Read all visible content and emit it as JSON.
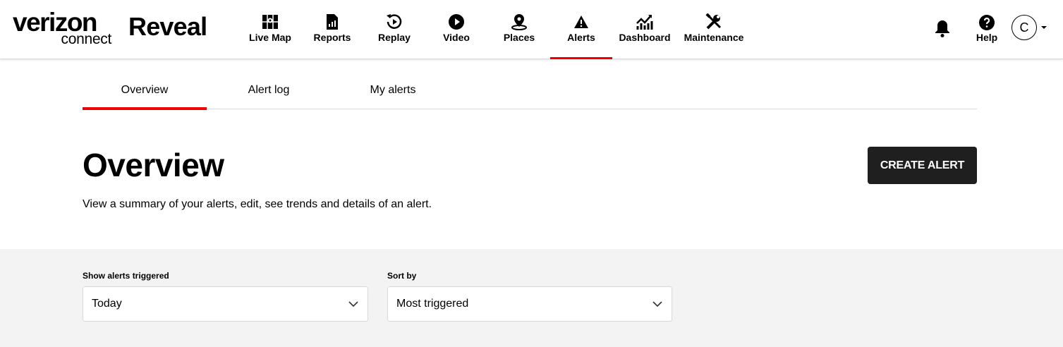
{
  "brand": {
    "company": "verizon",
    "suffix": "connect",
    "product": "Reveal"
  },
  "nav": {
    "items": [
      {
        "label": "Live Map",
        "icon": "map-icon"
      },
      {
        "label": "Reports",
        "icon": "report-icon"
      },
      {
        "label": "Replay",
        "icon": "replay-icon"
      },
      {
        "label": "Video",
        "icon": "play-icon"
      },
      {
        "label": "Places",
        "icon": "place-pin-icon"
      },
      {
        "label": "Alerts",
        "icon": "warning-icon",
        "active": true
      },
      {
        "label": "Dashboard",
        "icon": "chart-icon"
      },
      {
        "label": "Maintenance",
        "icon": "tools-icon"
      }
    ],
    "help_label": "Help",
    "user_initial": "C"
  },
  "tabs": [
    {
      "label": "Overview",
      "active": true
    },
    {
      "label": "Alert log"
    },
    {
      "label": "My alerts"
    }
  ],
  "page": {
    "title": "Overview",
    "description": "View a summary of your alerts, edit, see trends and details of an alert.",
    "create_button": "CREATE ALERT"
  },
  "filters": {
    "triggered": {
      "label": "Show alerts triggered",
      "value": "Today"
    },
    "sort": {
      "label": "Sort by",
      "value": "Most triggered"
    }
  },
  "colors": {
    "accent": "#ee0000",
    "button": "#1f1f1f",
    "filter_bg": "#f3f3f3"
  }
}
